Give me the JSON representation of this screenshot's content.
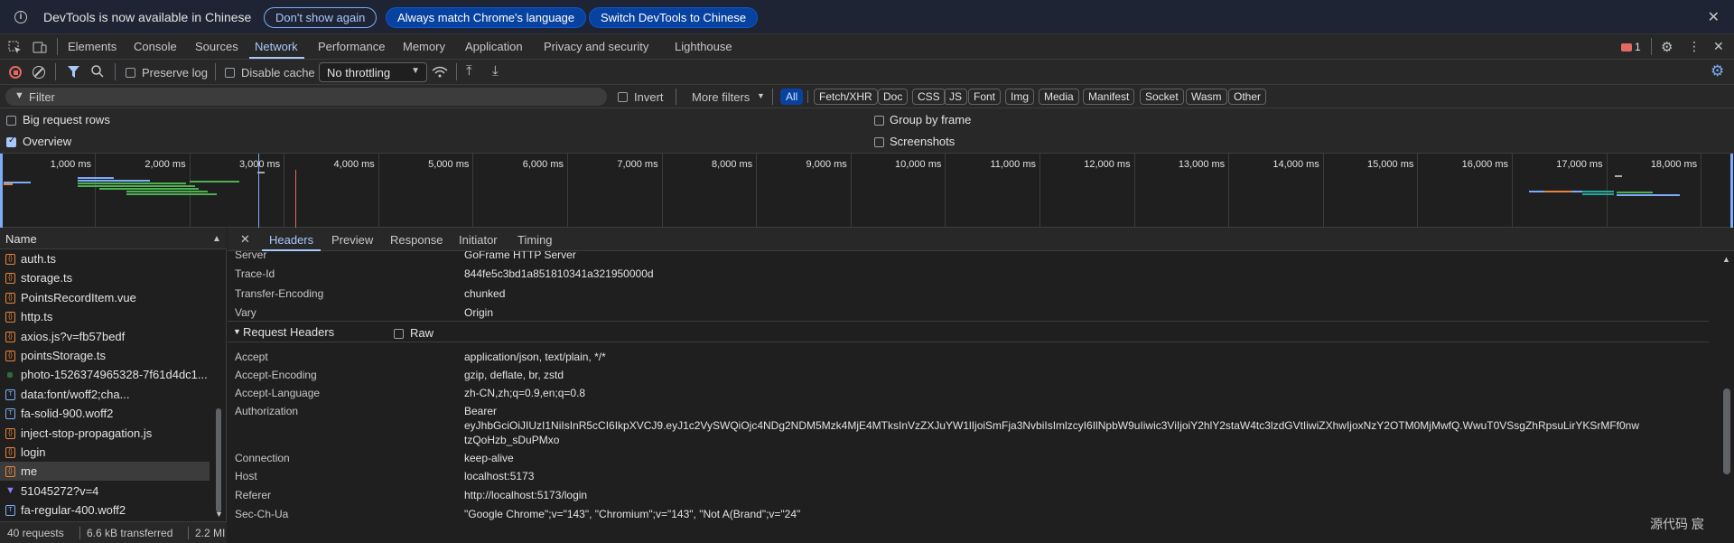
{
  "infobar": {
    "message": "DevTools is now available in Chinese",
    "btn_dont_show": "Don't show again",
    "btn_always_match": "Always match Chrome's language",
    "btn_switch": "Switch DevTools to Chinese",
    "close": "✕"
  },
  "tabs": [
    "Elements",
    "Console",
    "Sources",
    "Network",
    "Performance",
    "Memory",
    "Application",
    "Privacy and security",
    "Lighthouse"
  ],
  "active_tab": "Network",
  "issues_count": "1",
  "toolbar": {
    "preserve_log": "Preserve log",
    "disable_cache": "Disable cache",
    "throttling": "No throttling"
  },
  "filterbar": {
    "placeholder": "Filter",
    "invert": "Invert",
    "more_filters": "More filters",
    "chips": [
      "All",
      "Fetch/XHR",
      "Doc",
      "CSS",
      "JS",
      "Font",
      "Img",
      "Media",
      "Manifest",
      "Socket",
      "Wasm",
      "Other"
    ]
  },
  "options": {
    "big_request_rows": "Big request rows",
    "overview": "Overview",
    "group_by_frame": "Group by frame",
    "screenshots": "Screenshots"
  },
  "timeline_ticks": [
    "1,000 ms",
    "2,000 ms",
    "3,000 ms",
    "4,000 ms",
    "5,000 ms",
    "6,000 ms",
    "7,000 ms",
    "8,000 ms",
    "9,000 ms",
    "10,000 ms",
    "11,000 ms",
    "12,000 ms",
    "13,000 ms",
    "14,000 ms",
    "15,000 ms",
    "16,000 ms",
    "17,000 ms",
    "18,000 ms"
  ],
  "requests": {
    "header": "Name",
    "items": [
      {
        "name": "auth.ts",
        "type": "script"
      },
      {
        "name": "storage.ts",
        "type": "script"
      },
      {
        "name": "PointsRecordItem.vue",
        "type": "script"
      },
      {
        "name": "http.ts",
        "type": "script"
      },
      {
        "name": "axios.js?v=fb57bedf",
        "type": "script"
      },
      {
        "name": "pointsStorage.ts",
        "type": "script"
      },
      {
        "name": "photo-1526374965328-7f61d4dc1...",
        "type": "img"
      },
      {
        "name": "data:font/woff2;cha...",
        "type": "font"
      },
      {
        "name": "fa-solid-900.woff2",
        "type": "font"
      },
      {
        "name": "inject-stop-propagation.js",
        "type": "script"
      },
      {
        "name": "login",
        "type": "fetch"
      },
      {
        "name": "me",
        "type": "fetch"
      },
      {
        "name": "51045272?v=4",
        "type": "vue"
      },
      {
        "name": "fa-regular-400.woff2",
        "type": "font"
      }
    ],
    "footer_requests": "40 requests",
    "footer_transferred": "6.6 kB transferred",
    "footer_resources": "2.2 MI"
  },
  "details": {
    "tabs": [
      "Headers",
      "Preview",
      "Response",
      "Initiator",
      "Timing"
    ],
    "active": "Headers",
    "response_headers": [
      {
        "k": "Server",
        "v": "GoFrame HTTP Server"
      },
      {
        "k": "Trace-Id",
        "v": "844fe5c3bd1a851810341a321950000d"
      },
      {
        "k": "Transfer-Encoding",
        "v": "chunked"
      },
      {
        "k": "Vary",
        "v": "Origin"
      }
    ],
    "request_headers_title": "Request Headers",
    "raw_label": "Raw",
    "request_headers": [
      {
        "k": "Accept",
        "v": "application/json, text/plain, */*"
      },
      {
        "k": "Accept-Encoding",
        "v": "gzip, deflate, br, zstd"
      },
      {
        "k": "Accept-Language",
        "v": "zh-CN,zh;q=0.9,en;q=0.8"
      },
      {
        "k": "Authorization",
        "v": "Bearer"
      },
      {
        "k": "",
        "v": "eyJhbGciOiJIUzI1NiIsInR5cCI6IkpXVCJ9.eyJ1c2VySWQiOjc4NDg2NDM5Mzk4MjE4MTksInVzZXJuYW1lIjoiSmFja3NvbiIsImlzcyI6IlNpbW9uIiwic3ViIjoiY2hlY2staW4tc3lzdGVtIiwiZXhwIjoxNzY2OTM0MjMwfQ.WwuT0VSsgZhRpsuLirYKSrMFf0nw"
      },
      {
        "k": "",
        "v": "tzQoHzb_sDuPMxo"
      },
      {
        "k": "Connection",
        "v": "keep-alive"
      },
      {
        "k": "Host",
        "v": "localhost:5173"
      },
      {
        "k": "Referer",
        "v": "http://localhost:5173/login"
      },
      {
        "k": "Sec-Ch-Ua",
        "v": "\"Google Chrome\";v=\"143\", \"Chromium\";v=\"143\", \"Not A(Brand\";v=\"24\""
      }
    ]
  },
  "watermark": "源代码  宸",
  "colors": {
    "accent": "#a8c7fa",
    "bg": "#1f1f1f",
    "panel": "#282828"
  }
}
